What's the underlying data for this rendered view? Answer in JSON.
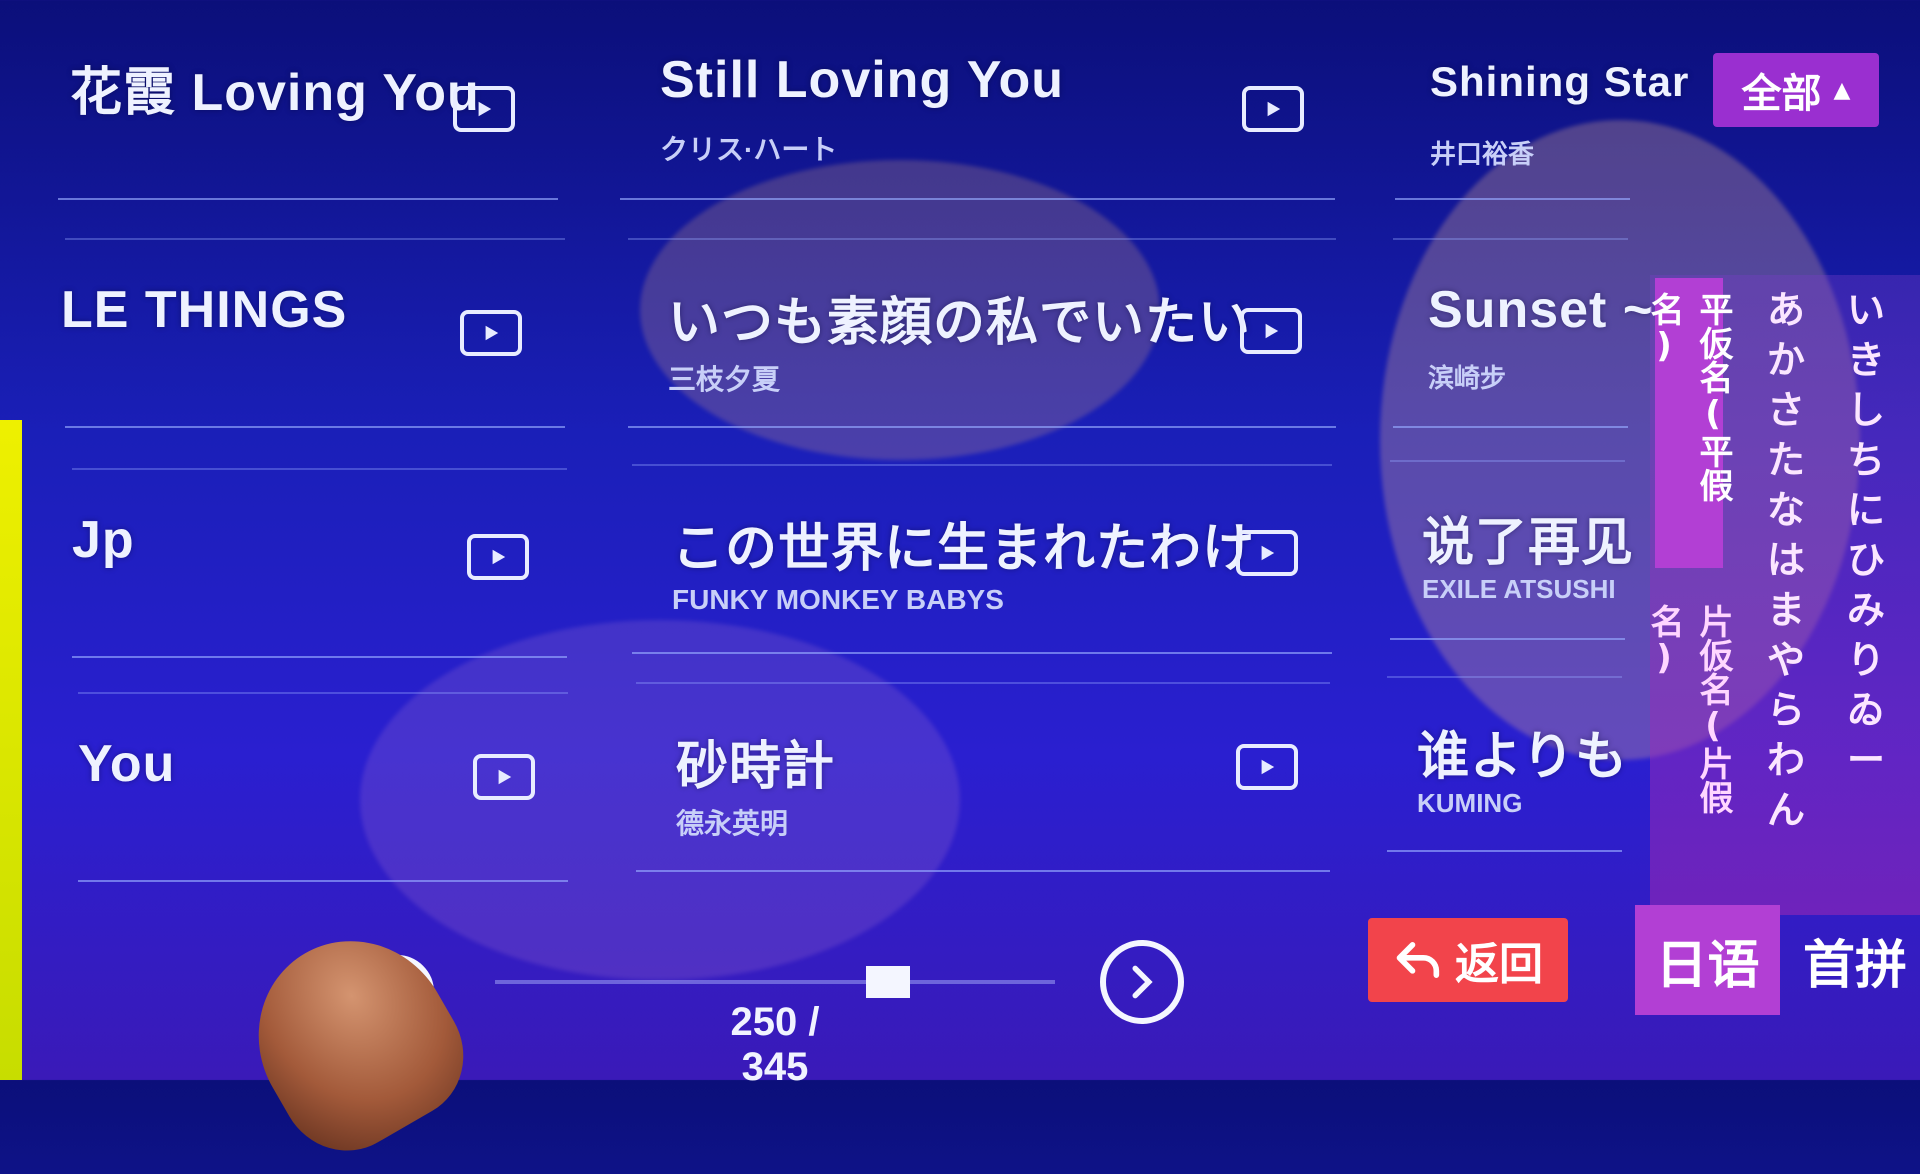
{
  "colors": {
    "accent": "#b23fd4",
    "filter_button": "#9a2fd0",
    "back_button": "#f2444b",
    "background": "#1a1fb8"
  },
  "filter": {
    "label": "全部",
    "icon": "caret-up-icon"
  },
  "songs": {
    "col1": [
      {
        "title": "花霞 Loving You",
        "artist": ""
      },
      {
        "title": "LE THINGS",
        "artist": ""
      },
      {
        "title": "Jp",
        "artist": ""
      },
      {
        "title": "You",
        "artist": ""
      }
    ],
    "col2": [
      {
        "title": "Still Loving You",
        "artist": "クリス·ハート"
      },
      {
        "title": "いつも素顔の私でいたい",
        "artist": "三枝夕夏"
      },
      {
        "title": "この世界に生まれたわけ",
        "artist": "FUNKY MONKEY BABYS"
      },
      {
        "title": "砂時計",
        "artist": "德永英明"
      }
    ],
    "col3": [
      {
        "title": "Shining Star",
        "artist": "井口裕香"
      },
      {
        "title": "Sunset ~",
        "artist": "滨崎步"
      },
      {
        "title": "说了再见",
        "artist": "EXILE ATSUSHI"
      },
      {
        "title": "谁よりも",
        "artist": "KUMING"
      }
    ]
  },
  "kana": {
    "tab_active": "平仮名(平假名)",
    "tab_inactive": "片仮名(片假名)",
    "col_a": [
      "あ",
      "か",
      "さ",
      "た",
      "な",
      "は",
      "ま",
      "や",
      "ら",
      "わ",
      "ん"
    ],
    "col_i": [
      "い",
      "き",
      "し",
      "ち",
      "に",
      "ひ",
      "み",
      "",
      "り",
      "ゐ",
      "ー"
    ]
  },
  "back": {
    "label": "返回"
  },
  "lang_tabs": {
    "japanese": "日语",
    "pinyin": "首拼"
  },
  "pager": {
    "current": 250,
    "total": 345,
    "text": "250 / 345",
    "progress": 0.725
  }
}
